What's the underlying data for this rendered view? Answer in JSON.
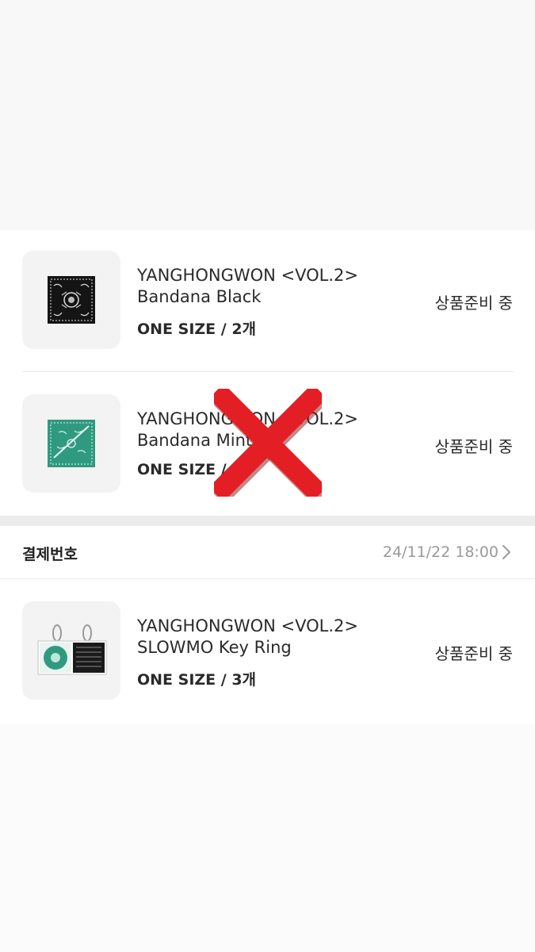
{
  "orders": [
    {
      "title_line1": "YANGHONGWON <VOL.2>",
      "title_line2": "Bandana Black",
      "option": "ONE SIZE / 2개",
      "status": "상품준비 중",
      "thumb_icon": "black-bandana-image"
    },
    {
      "title_line1": "YANGHONGWON <VOL.2>",
      "title_line2": "Bandana Mint",
      "option": "ONE SIZE / 1",
      "status": "상품준비 중",
      "thumb_icon": "mint-bandana-image",
      "crossed_out": true
    }
  ],
  "payment": {
    "label": "결제번호",
    "date": "24/11/22 18:00"
  },
  "payment_items": [
    {
      "title_line1": "YANGHONGWON <VOL.2>",
      "title_line2": "SLOWMO Key Ring",
      "option": "ONE SIZE / 3개",
      "status": "상품준비 중",
      "thumb_icon": "keyring-image"
    }
  ],
  "colors": {
    "cross": "#e31e24",
    "mint": "#2f9a7f",
    "black": "#1a1a1a"
  }
}
